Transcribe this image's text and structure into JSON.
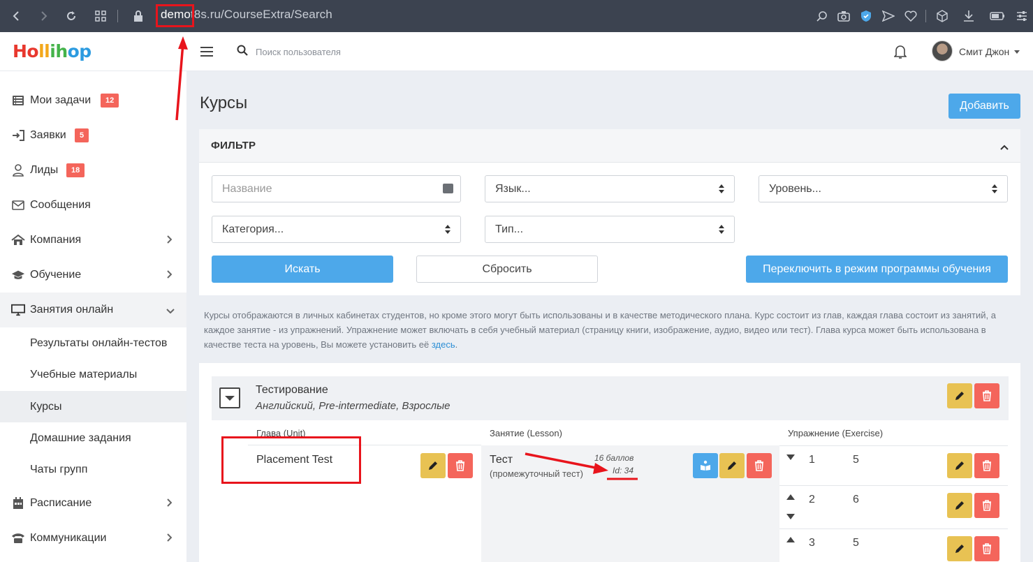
{
  "browser": {
    "url_host": "demo",
    "url_rest": "t8s.ru/CourseExtra/Search"
  },
  "topbar": {
    "logo": [
      "Ho",
      "ll",
      "ih",
      "op"
    ],
    "search_placeholder": "Поиск пользователя",
    "user_name": "Смит Джон"
  },
  "sidebar": {
    "items": [
      {
        "label": "Мои задачи",
        "badge": "12",
        "icon": "tasks-icon"
      },
      {
        "label": "Заявки",
        "badge": "5",
        "icon": "sign-in-icon"
      },
      {
        "label": "Лиды",
        "badge": "18",
        "icon": "user-icon"
      },
      {
        "label": "Сообщения",
        "icon": "envelope-icon"
      },
      {
        "label": "Компания",
        "icon": "home-icon"
      },
      {
        "label": "Обучение",
        "icon": "graduation-cap-icon"
      },
      {
        "label": "Занятия онлайн",
        "icon": "monitor-icon"
      },
      {
        "label": "Расписание",
        "icon": "calendar-icon"
      },
      {
        "label": "Коммуникации",
        "icon": "phone-icon"
      }
    ],
    "subitems": [
      {
        "label": "Результаты онлайн-тестов"
      },
      {
        "label": "Учебные материалы"
      },
      {
        "label": "Курсы"
      },
      {
        "label": "Домашние задания"
      },
      {
        "label": "Чаты групп"
      }
    ]
  },
  "main": {
    "title": "Курсы",
    "add_label": "Добавить",
    "filter": {
      "title": "ФИЛЬТР",
      "name_placeholder": "Название",
      "language": "Язык...",
      "level": "Уровень...",
      "category": "Категория...",
      "type": "Тип...",
      "search_label": "Искать",
      "reset_label": "Сбросить",
      "switch_label": "Переключить в режим программы обучения"
    },
    "info": "Курсы отображаются в личных кабинетах студентов, но кроме этого могут быть использованы и в качестве методического плана. Курс состоит из глав, каждая глава состоит из занятий, а каждое занятие - из упражнений. Упражнение может включать в себя учебный материал (страницу книги, изображение, аудио, видео или тест). Глава курса может быть использована в качестве теста на уровень, Вы можете установить её ",
    "info_link": "здесь",
    "info_end": "."
  },
  "course": {
    "name": "Тестирование",
    "subtitle": "Английский, Pre-intermediate, Взрослые",
    "col_unit": "Глава (Unit)",
    "col_lesson": "Занятие (Lesson)",
    "col_exercise": "Упражнение (Exercise)",
    "unit_name": "Placement Test",
    "lesson_name": "Тест",
    "lesson_type": "(промежуточный тест)",
    "lesson_score": "16 баллов",
    "lesson_id": "Id: 34",
    "exercises": [
      {
        "num": "1",
        "value": "5"
      },
      {
        "num": "2",
        "value": "6"
      },
      {
        "num": "3",
        "value": "5"
      }
    ]
  }
}
